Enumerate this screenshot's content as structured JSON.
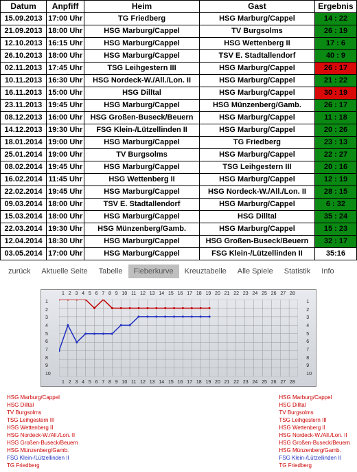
{
  "fixtures": {
    "headers": {
      "date": "Datum",
      "time": "Anpfiff",
      "home": "Heim",
      "away": "Gast",
      "result": "Ergebnis"
    },
    "rows": [
      {
        "date": "15.09.2013",
        "time": "17:00 Uhr",
        "home": "TG Friedberg",
        "away": "HSG Marburg/Cappel",
        "result": "14 : 22",
        "outcome": "green"
      },
      {
        "date": "21.09.2013",
        "time": "18:00 Uhr",
        "home": "HSG Marburg/Cappel",
        "away": "TV Burgsolms",
        "result": "26 : 19",
        "outcome": "green"
      },
      {
        "date": "12.10.2013",
        "time": "16:15 Uhr",
        "home": "HSG Marburg/Cappel",
        "away": "HSG Wettenberg II",
        "result": "17 : 6",
        "outcome": "green"
      },
      {
        "date": "26.10.2013",
        "time": "18:00 Uhr",
        "home": "HSG Marburg/Cappel",
        "away": "TSV E. Stadtallendorf",
        "result": "40 : 9",
        "outcome": "green"
      },
      {
        "date": "02.11.2013",
        "time": "17:45 Uhr",
        "home": "TSG Leihgestern III",
        "away": "HSG Marburg/Cappel",
        "result": "26 : 17",
        "outcome": "red"
      },
      {
        "date": "10.11.2013",
        "time": "16:30 Uhr",
        "home": "HSG Nordeck-W./All./Lon. II",
        "away": "HSG Marburg/Cappel",
        "result": "21 : 22",
        "outcome": "green"
      },
      {
        "date": "16.11.2013",
        "time": "15:00 Uhr",
        "home": "HSG Dilltal",
        "away": "HSG Marburg/Cappel",
        "result": "30 : 19",
        "outcome": "red"
      },
      {
        "date": "23.11.2013",
        "time": "19:45 Uhr",
        "home": "HSG Marburg/Cappel",
        "away": "HSG Münzenberg/Gamb.",
        "result": "26 : 17",
        "outcome": "green"
      },
      {
        "date": "08.12.2013",
        "time": "16:00 Uhr",
        "home": "HSG Großen-Buseck/Beuern",
        "away": "HSG Marburg/Cappel",
        "result": "11 : 18",
        "outcome": "green"
      },
      {
        "date": "14.12.2013",
        "time": "19:30 Uhr",
        "home": "FSG Klein-/Lützellinden II",
        "away": "HSG Marburg/Cappel",
        "result": "20 : 26",
        "outcome": "green"
      },
      {
        "date": "18.01.2014",
        "time": "19:00 Uhr",
        "home": "HSG Marburg/Cappel",
        "away": "TG Friedberg",
        "result": "23 : 13",
        "outcome": "green"
      },
      {
        "date": "25.01.2014",
        "time": "19:00 Uhr",
        "home": "TV Burgsolms",
        "away": "HSG Marburg/Cappel",
        "result": "22 : 27",
        "outcome": "green"
      },
      {
        "date": "08.02.2014",
        "time": "19:45 Uhr",
        "home": "HSG Marburg/Cappel",
        "away": "TSG Leihgestern III",
        "result": "20 : 16",
        "outcome": "green"
      },
      {
        "date": "16.02.2014",
        "time": "11:45 Uhr",
        "home": "HSG Wettenberg II",
        "away": "HSG Marburg/Cappel",
        "result": "12 : 19",
        "outcome": "green"
      },
      {
        "date": "22.02.2014",
        "time": "19:45 Uhr",
        "home": "HSG Marburg/Cappel",
        "away": "HSG Nordeck-W./All./Lon. II",
        "result": "28 : 15",
        "outcome": "green"
      },
      {
        "date": "09.03.2014",
        "time": "18:00 Uhr",
        "home": "TSV E. Stadtallendorf",
        "away": "HSG Marburg/Cappel",
        "result": "6 : 32",
        "outcome": "green"
      },
      {
        "date": "15.03.2014",
        "time": "18:00 Uhr",
        "home": "HSG Marburg/Cappel",
        "away": "HSG Dilltal",
        "result": "35 : 24",
        "outcome": "green"
      },
      {
        "date": "22.03.2014",
        "time": "19:30 Uhr",
        "home": "HSG Münzenberg/Gamb.",
        "away": "HSG Marburg/Cappel",
        "result": "15 : 23",
        "outcome": "green"
      },
      {
        "date": "12.04.2014",
        "time": "18:30 Uhr",
        "home": "HSG Marburg/Cappel",
        "away": "HSG Großen-Buseck/Beuern",
        "result": "32 : 17",
        "outcome": "green"
      },
      {
        "date": "03.05.2014",
        "time": "17:00 Uhr",
        "home": "HSG Marburg/Cappel",
        "away": "FSG Klein-/Lützellinden II",
        "result": "35:16",
        "outcome": "none"
      }
    ]
  },
  "nav": {
    "items": [
      {
        "label": "zurück",
        "active": false
      },
      {
        "label": "Aktuelle Seite",
        "active": false
      },
      {
        "label": "Tabelle",
        "active": false
      },
      {
        "label": "Fieberkurve",
        "active": true
      },
      {
        "label": "Kreuztabelle",
        "active": false
      },
      {
        "label": "Alle Spiele",
        "active": false
      },
      {
        "label": "Statistik",
        "active": false
      },
      {
        "label": "Info",
        "active": false
      }
    ]
  },
  "legends": {
    "left": [
      {
        "name": "HSG Marburg/Cappel",
        "blue": false
      },
      {
        "name": "HSG Dilltal",
        "blue": false
      },
      {
        "name": "TV Burgsolms",
        "blue": false
      },
      {
        "name": "TSG Leihgestern III",
        "blue": false
      },
      {
        "name": "HSG Wettenberg II",
        "blue": false
      },
      {
        "name": "HSG Nordeck-W./All./Lon. II",
        "blue": false
      },
      {
        "name": "HSG Großen-Buseck/Beuern",
        "blue": false
      },
      {
        "name": "HSG Münzenberg/Gamb.",
        "blue": false
      },
      {
        "name": "FSG Klein-/Lützellinden II",
        "blue": true
      },
      {
        "name": "TG Friedberg",
        "blue": false
      }
    ],
    "right": [
      {
        "name": "HSG Marburg/Cappel",
        "blue": false
      },
      {
        "name": "HSG Dilltal",
        "blue": false
      },
      {
        "name": "TV Burgsolms",
        "blue": false
      },
      {
        "name": "TSG Leihgestern III",
        "blue": false
      },
      {
        "name": "HSG Wettenberg II",
        "blue": false
      },
      {
        "name": "HSG Nordeck-W./All./Lon. II",
        "blue": false
      },
      {
        "name": "HSG Großen-Buseck/Beuern",
        "blue": false
      },
      {
        "name": "HSG Münzenberg/Gamb.",
        "blue": false
      },
      {
        "name": "FSG Klein-/Lützellinden II",
        "blue": true
      },
      {
        "name": "TG Friedberg",
        "blue": false
      }
    ]
  },
  "chart_data": {
    "type": "line",
    "title": "Fieberkurve",
    "xlabel": "",
    "ylabel": "",
    "x": [
      1,
      2,
      3,
      4,
      5,
      6,
      7,
      8,
      9,
      10,
      11,
      12,
      13,
      14,
      15,
      16,
      17,
      18,
      19,
      20,
      21,
      22,
      23,
      24,
      25,
      26,
      27,
      28
    ],
    "ylim": [
      1,
      10
    ],
    "y_inverted": true,
    "series": [
      {
        "name": "HSG Marburg/Cappel",
        "color": "#c00000",
        "values": [
          1,
          1,
          1,
          1,
          2,
          1,
          2,
          2,
          2,
          2,
          2,
          2,
          2,
          2,
          2,
          2,
          2,
          2
        ]
      },
      {
        "name": "FSG Klein-/Lützellinden II",
        "color": "#2030c0",
        "values": [
          7,
          4,
          6,
          5,
          5,
          5,
          5,
          4,
          4,
          3,
          3,
          3,
          3,
          3,
          3,
          3,
          3,
          3
        ]
      }
    ],
    "x_ticks_top": [
      1,
      2,
      3,
      4,
      5,
      6,
      7,
      8,
      9,
      10,
      11,
      12,
      13,
      14,
      15,
      16,
      17,
      18,
      19,
      20,
      21,
      22,
      23,
      24,
      25,
      26,
      27,
      28
    ],
    "x_ticks_bottom": [
      1,
      2,
      3,
      4,
      5,
      6,
      7,
      8,
      9,
      10,
      11,
      12,
      13,
      14,
      15,
      16,
      17,
      18,
      19,
      20,
      21,
      22,
      23,
      24,
      25,
      26,
      27,
      28
    ],
    "y_ticks": [
      1,
      2,
      3,
      4,
      5,
      6,
      7,
      8,
      9,
      10
    ]
  }
}
